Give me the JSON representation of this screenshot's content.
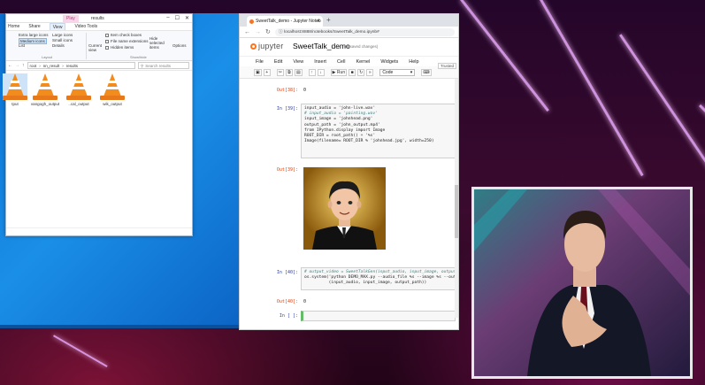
{
  "explorer": {
    "window_title": "results",
    "tools_tab": "Play",
    "ribbon_tabs": [
      "Home",
      "Share",
      "View",
      "Video Tools"
    ],
    "ribbon": {
      "extra_large_icons": "Extra large icons",
      "large_icons": "Large icons",
      "medium_icons": "Medium icons",
      "small_icons": "Small icons",
      "list": "List",
      "details": "Details",
      "layout_group": "Layout",
      "current_view": "Current view",
      "item_check_boxes": "Item check boxes",
      "file_name_extensions": "File name extensions",
      "hidden_items": "Hidden items",
      "hide_selected": "Hide selected items",
      "options": "Options",
      "show_hide_group": "Show/hide"
    },
    "breadcrumb": [
      "root",
      "nn_result",
      "results"
    ],
    "search_placeholder": "Search results",
    "files": [
      {
        "name": "tput"
      },
      {
        "name": "vangogh_output"
      },
      {
        "name": "..cal_output"
      },
      {
        "name": "wik_output"
      }
    ]
  },
  "browser": {
    "tab_title": "SweetTalk_demo - Jupyter Noteb",
    "url": "localhost:8888/notebooks/SweetTalk_demo.ipynb#"
  },
  "jupyter": {
    "logo": "jupyter",
    "notebook_name": "SweetTalk_demo",
    "save_status": "(unsaved changes)",
    "trusted": "Trusted",
    "menu": [
      "File",
      "Edit",
      "View",
      "Insert",
      "Cell",
      "Kernel",
      "Widgets",
      "Help"
    ],
    "toolbar": {
      "run_label": "Run",
      "cell_type": "Code"
    },
    "cells": {
      "out38_prompt": "Out[38]:",
      "out38_value": "0",
      "in39_prompt": "In [39]:",
      "in39_lines": [
        "input_audio = 'john-live.wav'",
        "# input_audio = 'painting.wav'",
        "",
        "input_image = 'johnhead.png'",
        "output_path = 'john_output.mp4'",
        "",
        "from IPython.display import Image",
        "ROOT_DIR = root_path() + '%s'",
        "Image(filename= ROOT_DIR % 'johnhead.jpg', width=250)"
      ],
      "out39_prompt": "Out[39]:",
      "in40_prompt": "In [40]:",
      "in40_lines": [
        "# output_video = SweetTalkGen(input_audio, input_image, output_path)",
        "os.system('python DEMO_MAX.py --audio_file %s --image %s --output %s' %",
        "          (input_audio, input_image, output_path))"
      ],
      "out40_prompt": "Out[40]:",
      "out40_value": "0",
      "in_empty_prompt": "In [ ]:"
    }
  }
}
